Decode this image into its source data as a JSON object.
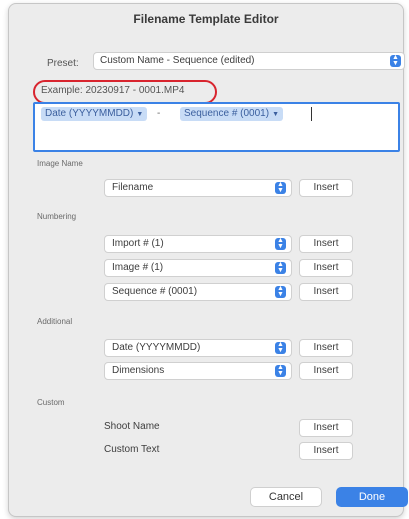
{
  "dialog": {
    "title": "Filename Template Editor"
  },
  "preset": {
    "label": "Preset:",
    "value": "Custom Name - Sequence (edited)"
  },
  "example": {
    "text": "Example: 20230917 - 0001.MP4"
  },
  "template_field": {
    "token_1": "Date (YYYYMMDD)",
    "separator": "-",
    "token_2": "Sequence # (0001)"
  },
  "sections": {
    "image_name": {
      "label": "Image Name",
      "rows": [
        {
          "value": "Filename",
          "insert": "Insert"
        }
      ]
    },
    "numbering": {
      "label": "Numbering",
      "rows": [
        {
          "value": "Import # (1)",
          "insert": "Insert"
        },
        {
          "value": "Image # (1)",
          "insert": "Insert"
        },
        {
          "value": "Sequence # (0001)",
          "insert": "Insert"
        }
      ]
    },
    "additional": {
      "label": "Additional",
      "rows": [
        {
          "value": "Date (YYYYMMDD)",
          "insert": "Insert"
        },
        {
          "value": "Dimensions",
          "insert": "Insert"
        }
      ]
    },
    "custom": {
      "label": "Custom",
      "rows": [
        {
          "value": "Shoot Name",
          "insert": "Insert"
        },
        {
          "value": "Custom Text",
          "insert": "Insert"
        }
      ]
    }
  },
  "buttons": {
    "cancel": "Cancel",
    "done": "Done"
  },
  "icons": {
    "stepper": "up-down-arrows-icon",
    "token_menu": "chevron-down-icon"
  },
  "colors": {
    "accent": "#3b82e6",
    "highlight_oval": "#d8242e",
    "token_bg": "#c8dcf6"
  }
}
